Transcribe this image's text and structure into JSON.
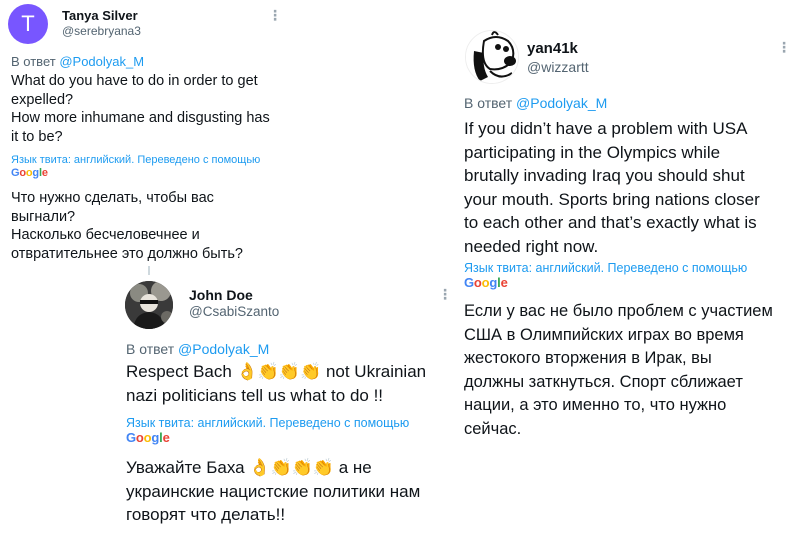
{
  "tweets": [
    {
      "author": "Tanya Silver",
      "handle": "@serebryana3",
      "avatar_letter": "T",
      "avatar_color": "#7856ff",
      "reply_prefix": "В ответ",
      "reply_mention": "@Podolyak_M",
      "original_lines": [
        "What do you have to do in order to get",
        "expelled?",
        "How more inhumane and disgusting has",
        "it to be?"
      ],
      "translation_note": "Язык твита: английский. Переведено с помощью",
      "translation_lines": [
        "Что нужно сделать, чтобы вас",
        "выгнали?",
        "Насколько бесчеловечнее и",
        "отвратительнее это должно быть?"
      ]
    },
    {
      "author": "John Doe",
      "handle": "@CsabiSzanto",
      "reply_prefix": "В ответ",
      "reply_mention": "@Podolyak_M",
      "original_lines": [
        "Respect Bach 👌👏👏👏 not Ukrainian",
        "nazi politicians tell us what to do !!"
      ],
      "translation_note": "Язык твита: английский. Переведено с помощью",
      "translation_lines": [
        "Уважайте Баха 👌👏👏👏 а не",
        "украинские нацистские политики нам",
        "говорят что делать!!"
      ]
    },
    {
      "author": "yan41k",
      "handle": "@wizzartt",
      "reply_prefix": "В ответ",
      "reply_mention": "@Podolyak_M",
      "original_lines": [
        "If you didn’t have a problem with USA",
        "participating in the Olympics while",
        "brutally invading Iraq you should shut",
        "your mouth. Sports bring nations closer",
        "to each other and that’s exactly what is",
        "needed right now."
      ],
      "translation_note": "Язык твита: английский. Переведено с помощью",
      "translation_lines": [
        "Если у вас не было проблем с участием",
        "США в Олимпийских играх во время",
        "жестокого вторжения в Ирак, вы",
        "должны заткнуться. Спорт сближает",
        "нации, а это именно то, что нужно",
        "сейчас."
      ]
    }
  ],
  "google_logo": [
    "G",
    "o",
    "o",
    "g",
    "l",
    "e"
  ],
  "more_icon": "vertical-ellipsis"
}
